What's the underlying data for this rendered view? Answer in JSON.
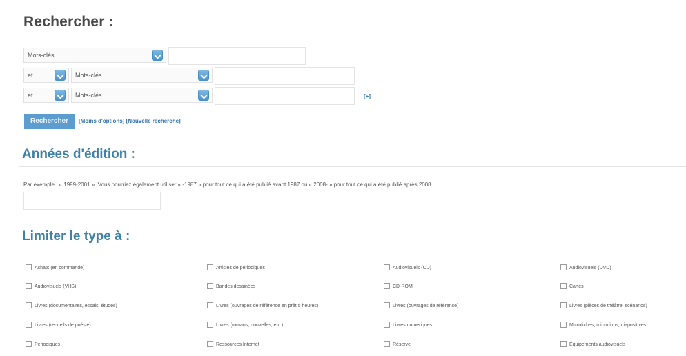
{
  "search": {
    "heading": "Rechercher :",
    "row1": {
      "field": "Mots-clés"
    },
    "row2": {
      "op": "et",
      "field": "Mots-clés"
    },
    "row3": {
      "op": "et",
      "field": "Mots-clés"
    },
    "add_label": "[+]",
    "submit_label": "Rechercher",
    "fewer_options": "[Moins d'options]",
    "new_search": "[Nouvelle recherche]"
  },
  "years": {
    "heading": "Années d'édition :",
    "hint": "Par exemple : « 1999-2001 ». Vous pourriez également utiliser « -1987 » pour tout ce qui a été publié avant 1987 ou « 2008- » pour tout ce qui a été publié après 2008."
  },
  "types": {
    "heading": "Limiter le type à :",
    "items": [
      "Achats (en commande)",
      "Articles de périodiques",
      "Audiovisuels (CD)",
      "Audiovisuels (DVD)",
      "Audiovisuels (VHS)",
      "Bandes dessinées",
      "CD-ROM",
      "Cartes",
      "Livres (documentaires, essais, études)",
      "Livres (ouvrages de référence en prêt 5 heures)",
      "Livres (ouvrages de référence)",
      "Livres (pièces de théâtre, scénarios)",
      "Livres (recueils de poésie)",
      "Livres (romans, nouvelles, etc.)",
      "Livres numériques",
      "Microfiches, microfilms, diapositives",
      "Périodiques",
      "Ressources Internet",
      "Réserve",
      "Équipements audiovisuels"
    ]
  }
}
